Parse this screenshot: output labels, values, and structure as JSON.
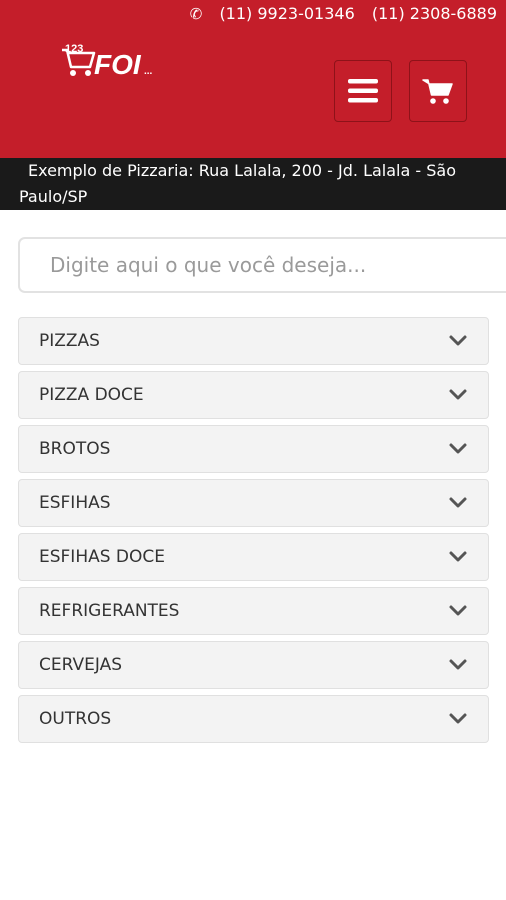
{
  "header": {
    "phone_icon": "phone-icon",
    "phones": [
      "(11) 9923-01346",
      "(11) 2308-6889"
    ],
    "logo_text": "123 FOI...",
    "menu_icon": "hamburger-menu-icon",
    "cart_icon": "shopping-cart-icon"
  },
  "address": "Exemplo de Pizzaria: Rua Lalala, 200 - Jd. Lalala - São Paulo/SP",
  "search": {
    "placeholder": "Digite aqui o que você deseja..."
  },
  "categories": [
    {
      "label": "PIZZAS"
    },
    {
      "label": "PIZZA DOCE"
    },
    {
      "label": "BROTOS"
    },
    {
      "label": "ESFIHAS"
    },
    {
      "label": "ESFIHAS DOCE"
    },
    {
      "label": "REFRIGERANTES"
    },
    {
      "label": "CERVEJAS"
    },
    {
      "label": "OUTROS"
    }
  ],
  "colors": {
    "brand_red": "#c41e2a",
    "address_bar": "#1a1a1a",
    "item_bg": "#f3f3f3"
  }
}
